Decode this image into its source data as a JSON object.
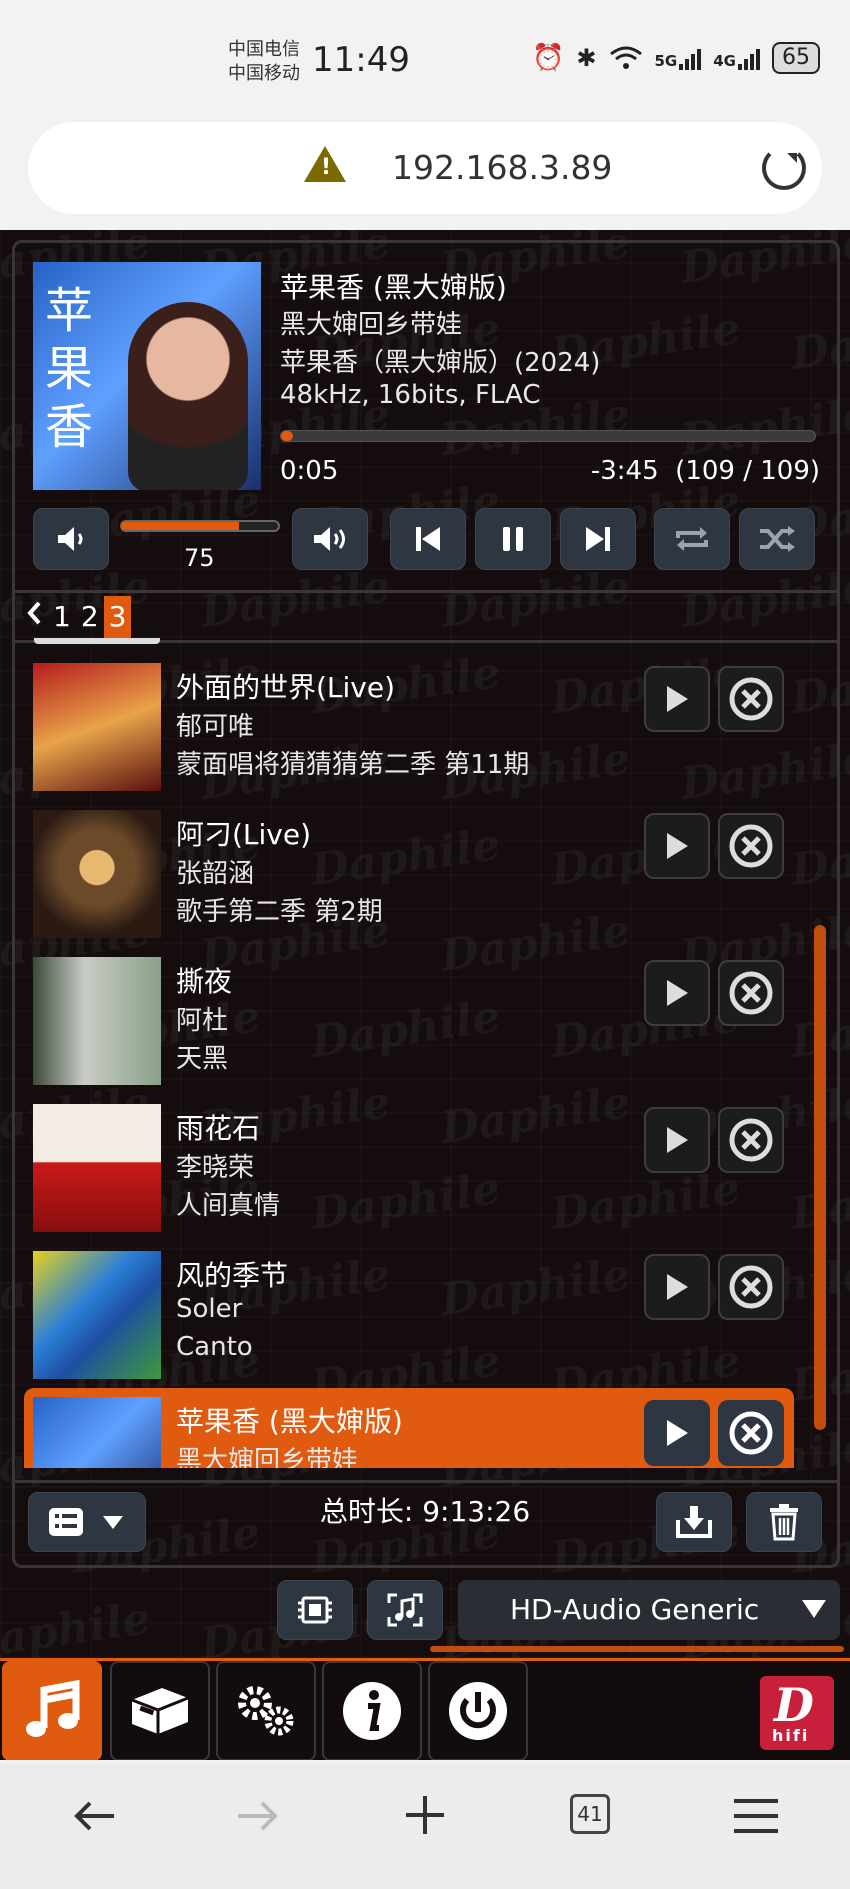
{
  "status_bar": {
    "carrier_1": "中国电信",
    "carrier_2": "中国移动",
    "time": "11:49",
    "signal_1_label": "5G",
    "signal_2_label": "4G",
    "battery": "65"
  },
  "browser": {
    "url": "192.168.3.89",
    "tab_count": "41"
  },
  "now_playing": {
    "title": "苹果香 (黑大婶版)",
    "artist": "黑大婶回乡带娃",
    "album": "苹果香（黑大婶版）(2024)",
    "format": "48kHz, 16bits, FLAC",
    "elapsed": "0:05",
    "remaining": "-3:45",
    "position": "(109 / 109)",
    "progress_fraction": 0.022,
    "cover_text": "苹果香",
    "volume": "75",
    "volume_fraction": 0.75
  },
  "pager": {
    "prev_icon": "chevron-left-icon",
    "pages": [
      "1",
      "2",
      "3"
    ],
    "active_page": "3"
  },
  "playlist": [
    {
      "title": "外面的世界(Live)",
      "artist": "郁可唯",
      "album": "蒙面唱将猜猜猜第二季 第11期",
      "current": false
    },
    {
      "title": "阿刁(Live)",
      "artist": "张韶涵",
      "album": "歌手第二季 第2期",
      "current": false
    },
    {
      "title": "撕夜",
      "artist": "阿杜",
      "album": "天黑",
      "current": false
    },
    {
      "title": "雨花石",
      "artist": "李晓荣",
      "album": "人间真情",
      "current": false
    },
    {
      "title": "风的季节",
      "artist": "Soler",
      "album": "Canto",
      "current": false
    },
    {
      "title": "苹果香 (黑大婶版)",
      "artist": "黑大婶回乡带娃",
      "album": "",
      "current": true
    }
  ],
  "playlist_footer": {
    "total_duration": "总时长: 9:13:26"
  },
  "output": {
    "device": "HD-Audio Generic"
  },
  "nav": {
    "logo_letter": "D",
    "logo_sub": "hifi"
  },
  "colors": {
    "accent": "#e05a10",
    "button_bg": "#2e3642",
    "app_bg": "#150d0d"
  }
}
